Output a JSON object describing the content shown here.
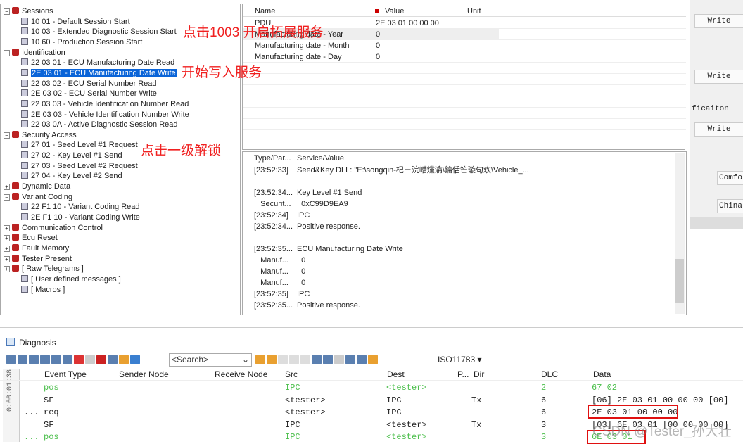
{
  "tree": [
    {
      "label": "Sessions",
      "type": "group",
      "expanded": true
    },
    {
      "label": "10 01 - Default Session Start",
      "type": "leaf"
    },
    {
      "label": "10 03 - Extended Diagnostic Session Start",
      "type": "leaf"
    },
    {
      "label": "10 60 - Production Session Start",
      "type": "leaf"
    },
    {
      "label": "Identification",
      "type": "group",
      "expanded": true
    },
    {
      "label": "22 03 01 - ECU Manufacturing Date Read",
      "type": "leaf"
    },
    {
      "label": "2E 03 01 - ECU Manufacturing Date Write",
      "type": "leaf",
      "selected": true
    },
    {
      "label": "22 03 02 - ECU Serial Number Read",
      "type": "leaf"
    },
    {
      "label": "2E 03 02 - ECU Serial Number Write",
      "type": "leaf"
    },
    {
      "label": "22 03 03 - Vehicle Identification Number Read",
      "type": "leaf"
    },
    {
      "label": "2E 03 03 - Vehicle Identification Number Write",
      "type": "leaf"
    },
    {
      "label": "22 03 0A - Active Diagnostic Session Read",
      "type": "leaf"
    },
    {
      "label": "Security Access",
      "type": "group",
      "expanded": true
    },
    {
      "label": "27 01 - Seed Level #1 Request",
      "type": "leaf"
    },
    {
      "label": "27 02 - Key Level #1 Send",
      "type": "leaf"
    },
    {
      "label": "27 03 - Seed Level #2 Request",
      "type": "leaf"
    },
    {
      "label": "27 04 - Key Level #2 Send",
      "type": "leaf"
    },
    {
      "label": "Dynamic Data",
      "type": "group",
      "expanded": false
    },
    {
      "label": "Variant Coding",
      "type": "group",
      "expanded": true
    },
    {
      "label": "22 F1 10 - Variant Coding Read",
      "type": "leaf"
    },
    {
      "label": "2E F1 10 - Variant Coding Write",
      "type": "leaf"
    },
    {
      "label": "Communication Control",
      "type": "group",
      "expanded": false
    },
    {
      "label": "Ecu Reset",
      "type": "group",
      "expanded": false
    },
    {
      "label": "Fault Memory",
      "type": "group",
      "expanded": false
    },
    {
      "label": "Tester Present",
      "type": "group",
      "expanded": false
    },
    {
      "label": "[ Raw Telegrams ]",
      "type": "group",
      "expanded": false
    },
    {
      "label": "[ User defined messages ]",
      "type": "leaf"
    },
    {
      "label": "[ Macros ]",
      "type": "leaf"
    }
  ],
  "params": {
    "headers": [
      "Name",
      "Value",
      "Unit"
    ],
    "rows": [
      {
        "name": "PDU",
        "value": "2E 03 01 00 00 00",
        "unit": ""
      },
      {
        "name": "Manufacturing date - Year",
        "value": "0",
        "unit": ""
      },
      {
        "name": "Manufacturing date - Month",
        "value": "0",
        "unit": ""
      },
      {
        "name": "Manufacturing date - Day",
        "value": "0",
        "unit": ""
      }
    ]
  },
  "log": {
    "headers": [
      "Type/Par...",
      "Service/Value"
    ],
    "rows": [
      {
        "a": "[23:52:33]",
        "b": "Seed&Key DLL: \"E:\\songqin-杞ㄧ浣嶆爣瀹\\鑰佸笀璇句欢\\Vehicle_..."
      },
      {
        "a": "",
        "b": ""
      },
      {
        "a": "[23:52:34...",
        "b": "Key Level #1 Send"
      },
      {
        "a": "   Securit...",
        "b": "  0xC99D9EA9"
      },
      {
        "a": "[23:52:34]",
        "b": "IPC"
      },
      {
        "a": "[23:52:34...",
        "b": "Positive response."
      },
      {
        "a": "",
        "b": ""
      },
      {
        "a": "[23:52:35...",
        "b": "ECU Manufacturing Date Write"
      },
      {
        "a": "   Manuf...",
        "b": "  0"
      },
      {
        "a": "   Manuf...",
        "b": "  0"
      },
      {
        "a": "   Manuf...",
        "b": "  0"
      },
      {
        "a": "[23:52:35]",
        "b": "IPC"
      },
      {
        "a": "[23:52:35...",
        "b": "Positive response."
      }
    ]
  },
  "right": {
    "write": "Write",
    "label": "ficaiton",
    "comfort": "Comfor",
    "china": "China"
  },
  "annotations": [
    "点击1003 开启拓展服务",
    "开始写入服务",
    "点击一级解锁"
  ],
  "diag": {
    "title": "Diagnosis",
    "search_placeholder": "<Search>",
    "protocol": "ISO11783",
    "time": "0:00:01:38",
    "headers": [
      "Event Type",
      "Sender Node",
      "Receive Node",
      "Src",
      "Dest",
      "P...",
      "Dir",
      "DLC",
      "Data"
    ],
    "rows": [
      {
        "pre": "",
        "type": "pos",
        "src": "IPC",
        "dest": "<tester>",
        "dir": "",
        "dlc": "2",
        "data": "67 02",
        "green": true
      },
      {
        "pre": "",
        "type": "SF",
        "src": "<tester>",
        "dest": "IPC",
        "dir": "Tx",
        "dlc": "6",
        "data": "[06] 2E 03 01 00 00 00 [00]",
        "green": false
      },
      {
        "pre": "...",
        "type": "req",
        "src": "<tester>",
        "dest": "IPC",
        "dir": "",
        "dlc": "6",
        "data": "2E 03 01 00 00 00",
        "green": false
      },
      {
        "pre": "",
        "type": "SF",
        "src": "IPC",
        "dest": "<tester>",
        "dir": "Tx",
        "dlc": "3",
        "data": "[03] 6E 03 01 [00 00 00 00]",
        "green": false
      },
      {
        "pre": "...",
        "type": "pos",
        "src": "IPC",
        "dest": "<tester>",
        "dir": "",
        "dlc": "3",
        "data": "6E 03 01",
        "green": true
      }
    ]
  },
  "watermark": "CSDN @Tester_孙大壮",
  "colors": {
    "selection": "#0a64d8",
    "annotation": "#f02020",
    "positive": "#4cbf4c"
  }
}
